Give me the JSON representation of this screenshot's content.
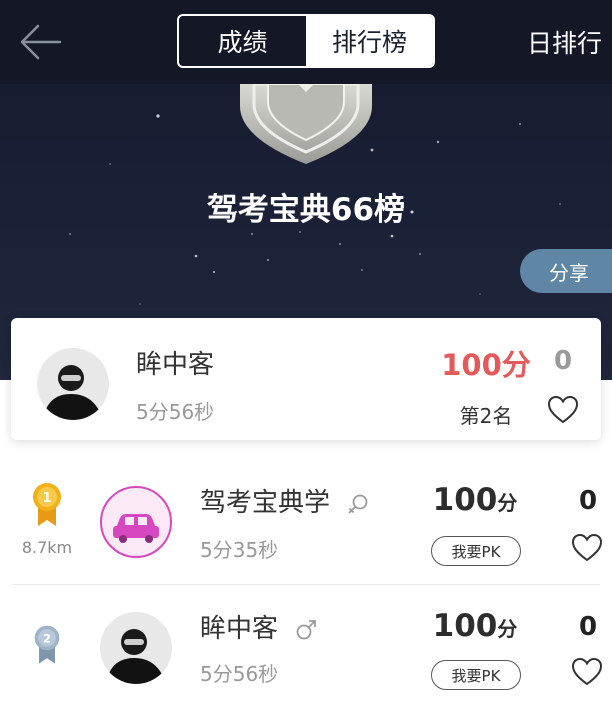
{
  "header": {
    "tabs": [
      {
        "label": "成绩",
        "active": false
      },
      {
        "label": "排行榜",
        "active": true
      }
    ],
    "day_rank_label": "日排行"
  },
  "hero": {
    "title": "驾考宝典66榜",
    "share_label": "分享"
  },
  "my_entry": {
    "name": "眸中客",
    "time": "5分56秒",
    "score": "100分",
    "rank": "第2名",
    "likes": "0"
  },
  "ranking": [
    {
      "rank": 1,
      "distance": "8.7km",
      "name": "驾考宝典学",
      "gender": "female",
      "time": "5分35秒",
      "score_value": "100",
      "score_unit": "分",
      "pk_label": "我要PK",
      "likes": "0"
    },
    {
      "rank": 2,
      "distance": "",
      "name": "眸中客",
      "gender": "male",
      "time": "5分56秒",
      "score_value": "100",
      "score_unit": "分",
      "pk_label": "我要PK",
      "likes": "0"
    }
  ],
  "colors": {
    "header_bg": "#131726",
    "hero_bg": "#1a2036",
    "score_highlight": "#e45a5a",
    "share_bg": "#5f86a4",
    "gold_medal": "#f3b019",
    "silver_medal": "#9fb3c8",
    "car_avatar": "#d648c0"
  }
}
